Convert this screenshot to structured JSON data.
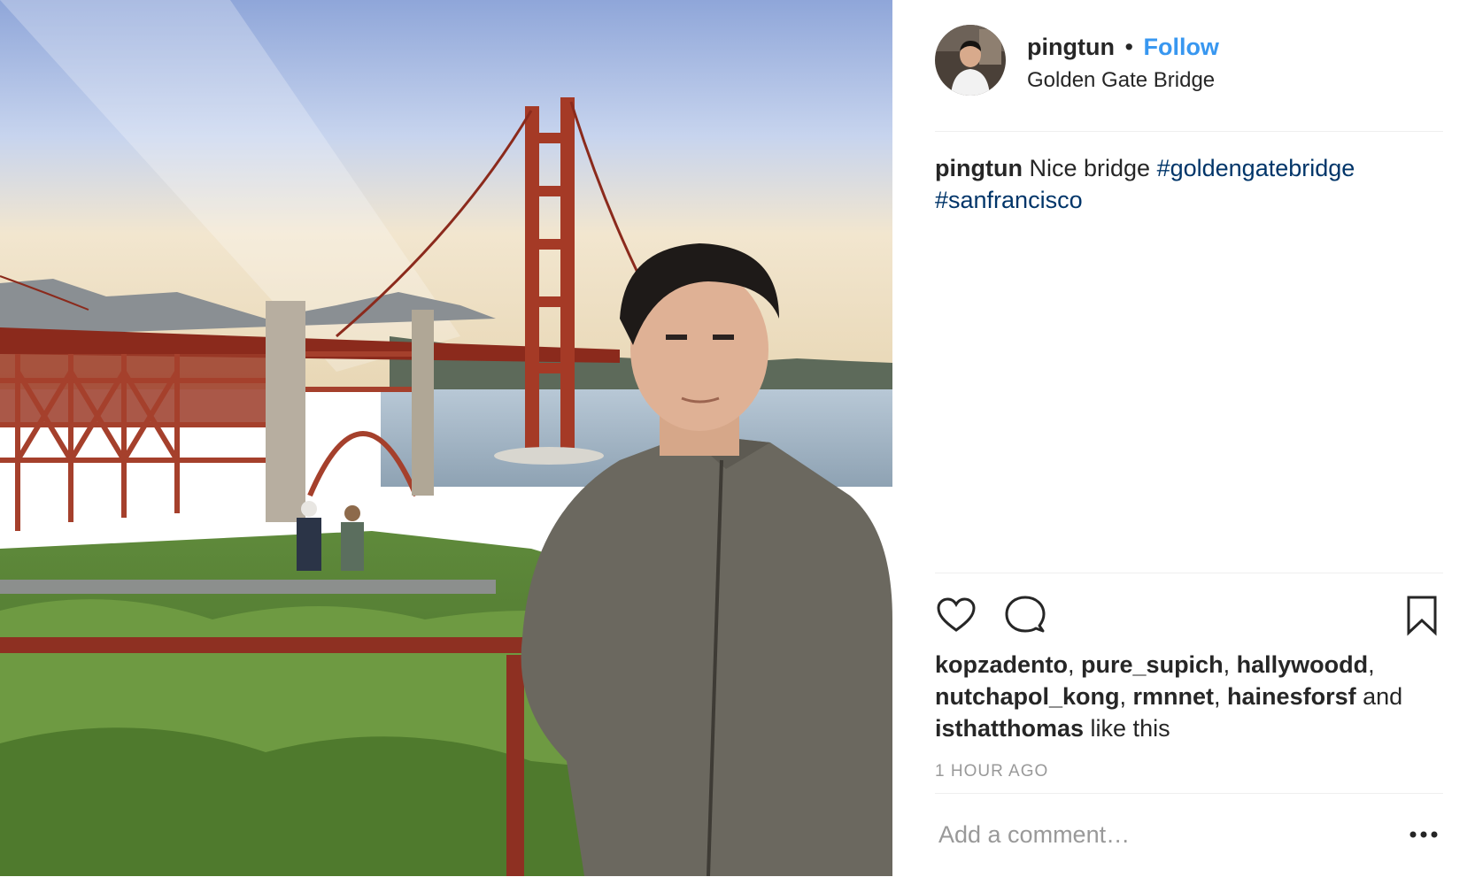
{
  "post": {
    "username": "pingtun",
    "separator": "•",
    "follow_label": "Follow",
    "location": "Golden Gate Bridge",
    "caption": {
      "username": "pingtun",
      "text": "Nice bridge",
      "hashtags": [
        "#goldengatebridge",
        "#sanfrancisco"
      ]
    },
    "likes": {
      "users": [
        "kopzadento",
        "pure_supich",
        "hallywoodd",
        "nutchapol_kong",
        "rmnnet",
        "hainesforsf"
      ],
      "and_label": "and",
      "last_user": "isthatthomas",
      "suffix": "like this"
    },
    "timestamp": "1 HOUR AGO",
    "comment_placeholder": "Add a comment…",
    "icons": [
      "heart-icon",
      "comment-icon",
      "bookmark-icon",
      "more-options-icon"
    ],
    "colors": {
      "follow": "#3897f0",
      "hashtag": "#003569",
      "muted": "#999999"
    }
  }
}
